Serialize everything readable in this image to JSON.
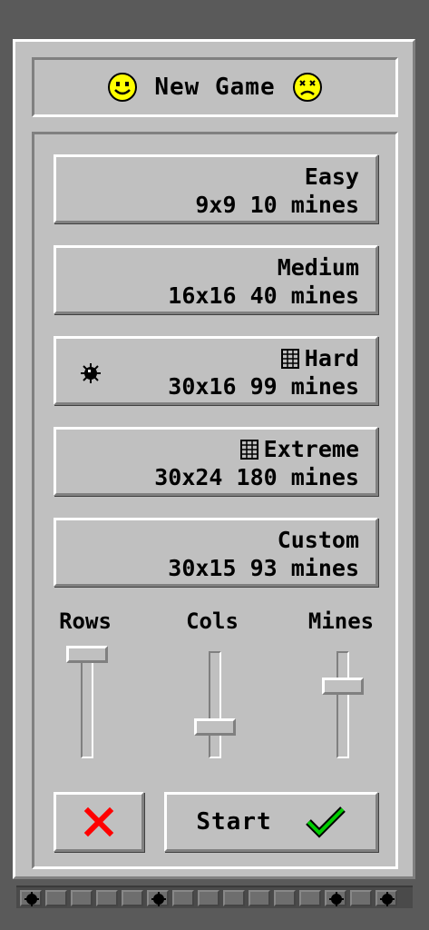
{
  "dialog": {
    "title": "New Game",
    "left_icon": "smiley-happy-icon",
    "right_icon": "smiley-dead-icon"
  },
  "levels": [
    {
      "name": "Easy",
      "desc": "9x9 10 mines",
      "icon": ""
    },
    {
      "name": "Medium",
      "desc": "16x16 40 mines",
      "icon": ""
    },
    {
      "name": "Hard",
      "desc": "30x16 99 mines",
      "icon": "grid-icon",
      "selected_marker": "mine-icon"
    },
    {
      "name": "Extreme",
      "desc": "30x24 180 mines",
      "icon": "grid-icon"
    },
    {
      "name": "Custom",
      "desc": "30x15 93 mines",
      "icon": ""
    }
  ],
  "sliders": {
    "rows": {
      "label": "Rows",
      "level": 1.0
    },
    "cols": {
      "label": "Cols",
      "level": 0.2
    },
    "mines": {
      "label": "Mines",
      "level": 0.65
    }
  },
  "buttons": {
    "cancel_icon": "close-x-icon",
    "start_label": "Start",
    "start_icon": "checkmark-icon"
  },
  "colors": {
    "panel": "#c0c0c0",
    "highlight": "#ffffff",
    "shadow": "#808080",
    "smiley": "#ffff00",
    "cancel_red": "#ff0000",
    "check_green": "#00cc00"
  }
}
